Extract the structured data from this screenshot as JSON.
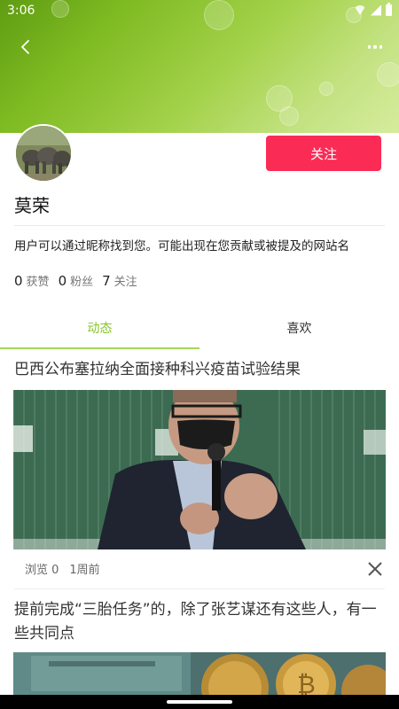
{
  "status_bar": {
    "time": "3:06"
  },
  "profile": {
    "follow_label": "关注",
    "name": "莫荣",
    "bio": "用户可以通过昵称找到您。可能出现在您贡献或被提及的网站名",
    "stats": [
      {
        "count": "0",
        "label": "获赞"
      },
      {
        "count": "0",
        "label": "粉丝"
      },
      {
        "count": "7",
        "label": "关注"
      }
    ]
  },
  "tabs": [
    {
      "label": "动态",
      "active": true
    },
    {
      "label": "喜欢",
      "active": false
    }
  ],
  "articles": [
    {
      "title": "巴西公布塞拉纳全面接种科兴疫苗试验结果",
      "views": "浏览 0",
      "time": "1周前"
    },
    {
      "title": "提前完成“三胎任务”的，除了张艺谋还有这些人，有一些共同点"
    }
  ],
  "colors": {
    "accent_green": "#86c52b",
    "follow_red": "#fa2c56"
  }
}
